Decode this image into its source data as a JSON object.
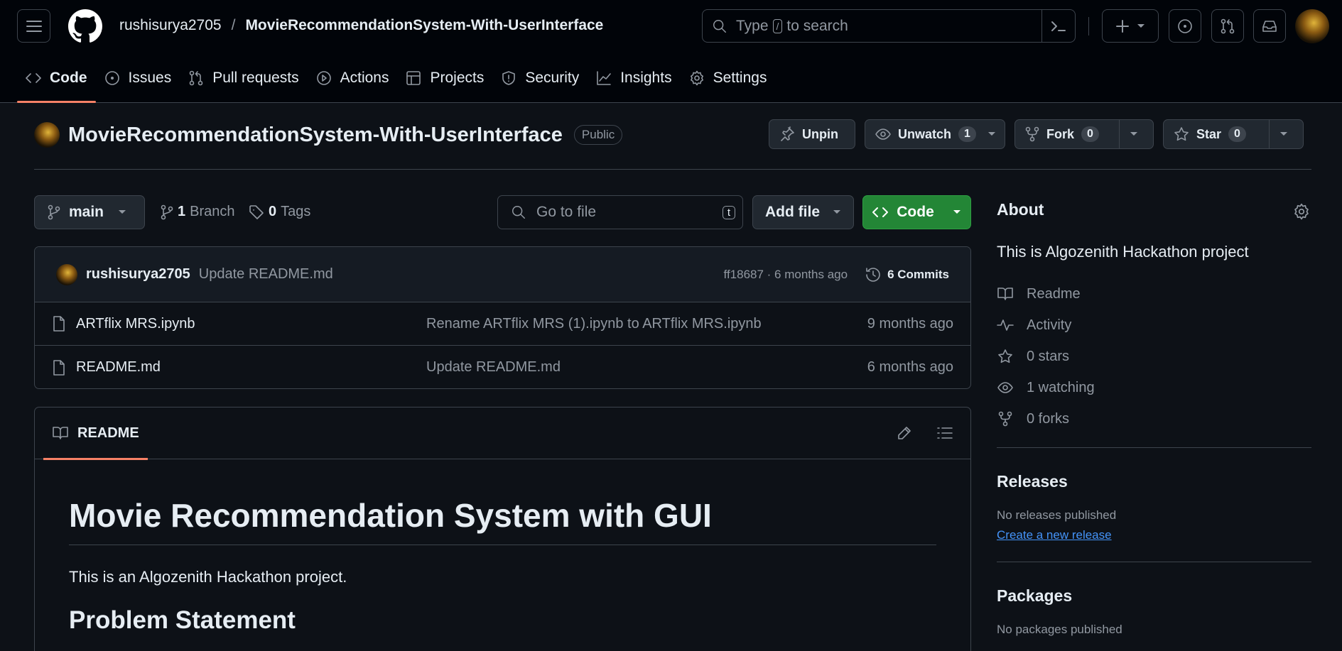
{
  "header": {
    "owner": "rushisurya2705",
    "separator": "/",
    "repo": "MovieRecommendationSystem-With-UserInterface",
    "search_prefix": "Type",
    "search_key": "/",
    "search_suffix": "to search"
  },
  "repo_tabs": [
    {
      "label": "Code"
    },
    {
      "label": "Issues"
    },
    {
      "label": "Pull requests"
    },
    {
      "label": "Actions"
    },
    {
      "label": "Projects"
    },
    {
      "label": "Security"
    },
    {
      "label": "Insights"
    },
    {
      "label": "Settings"
    }
  ],
  "repo_header": {
    "name": "MovieRecommendationSystem-With-UserInterface",
    "visibility": "Public",
    "unpin_label": "Unpin",
    "watch_label": "Unwatch",
    "watch_count": "1",
    "fork_label": "Fork",
    "fork_count": "0",
    "star_label": "Star",
    "star_count": "0"
  },
  "file_nav": {
    "branch": "main",
    "branch_count": "1",
    "branch_label": "Branch",
    "tag_count": "0",
    "tag_label": "Tags",
    "goto_placeholder": "Go to file",
    "goto_key": "t",
    "add_file_label": "Add file",
    "code_label": "Code"
  },
  "latest_commit": {
    "author": "rushisurya2705",
    "message": "Update README.md",
    "hash_time": "ff18687 · 6 months ago",
    "commits_label": "6 Commits"
  },
  "files": [
    {
      "name": "ARTflix MRS.ipynb",
      "message": "Rename ARTflix MRS (1).ipynb to ARTflix MRS.ipynb",
      "date": "9 months ago"
    },
    {
      "name": "README.md",
      "message": "Update README.md",
      "date": "6 months ago"
    }
  ],
  "readme": {
    "tab_label": "README",
    "h1": "Movie Recommendation System with GUI",
    "intro": "This is an Algozenith Hackathon project.",
    "h2": "Problem Statement"
  },
  "about": {
    "title": "About",
    "description": "This is Algozenith Hackathon project",
    "items": [
      {
        "icon": "book-icon",
        "label": "Readme"
      },
      {
        "icon": "pulse-icon",
        "label": "Activity"
      },
      {
        "icon": "star-icon",
        "label": "0 stars"
      },
      {
        "icon": "eye-icon",
        "label": "1 watching"
      },
      {
        "icon": "fork-icon",
        "label": "0 forks"
      }
    ]
  },
  "releases": {
    "title": "Releases",
    "empty": "No releases published",
    "link": "Create a new release"
  },
  "packages": {
    "title": "Packages",
    "empty": "No packages published"
  },
  "colors": {
    "background": "#0d1117",
    "header_bg": "#010409",
    "border": "#3d444d",
    "accent_tab": "#f78166",
    "code_button": "#238636",
    "link": "#4493f8"
  }
}
